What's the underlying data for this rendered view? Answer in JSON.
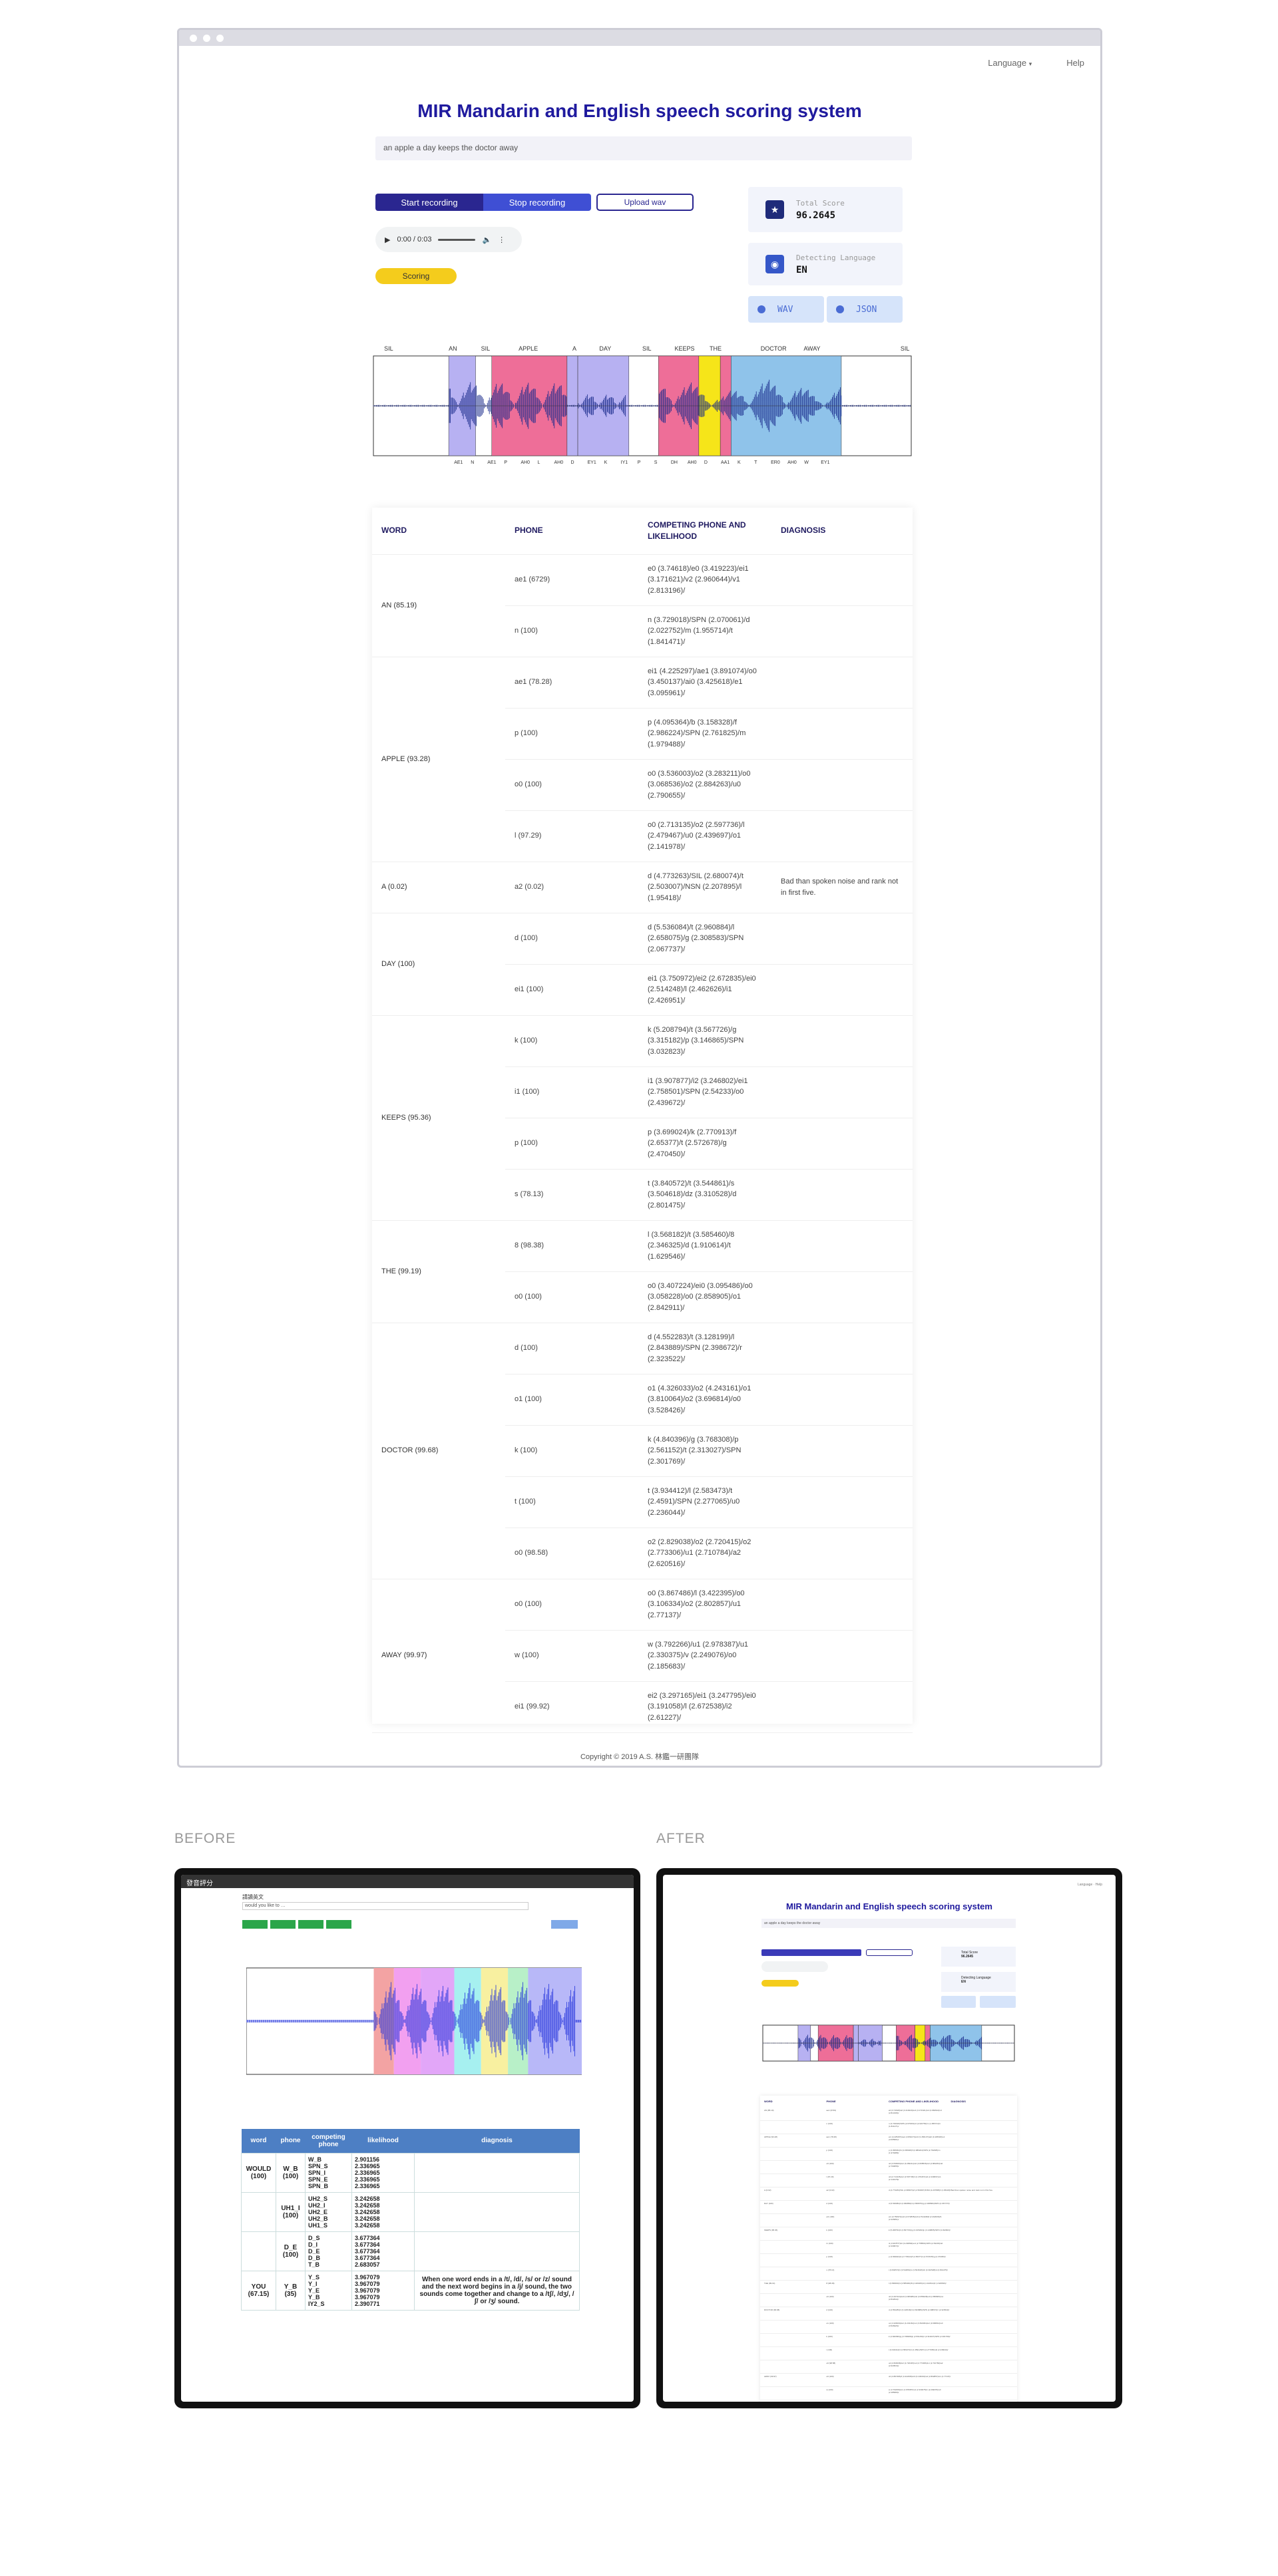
{
  "header": {
    "language_menu": "Language",
    "help_link": "Help",
    "title": "MIR Mandarin and English speech scoring system",
    "sentence": "an apple a day keeps the doctor away"
  },
  "controls": {
    "start_recording": "Start recording",
    "stop_recording": "Stop recording",
    "upload_wav": "Upload wav",
    "player_time": "0:00 / 0:03",
    "scoring": "Scoring"
  },
  "score_cards": {
    "total_label": "Total Score",
    "total_value": "96.2645",
    "lang_label": "Detecting Language",
    "lang_value": "EN",
    "wav_button": "WAV",
    "json_button": "JSON"
  },
  "waveform": {
    "word_labels": [
      "SIL",
      "AN",
      "SIL",
      "APPLE",
      "A",
      "DAY",
      "SIL",
      "KEEPS",
      "THE",
      "DOCTOR",
      "AWAY",
      "SIL"
    ],
    "phone_labels": [
      "AE1",
      "N",
      "AE1",
      "P",
      "AH0",
      "L",
      "AH0",
      "D",
      "EY1",
      "K",
      "IY1",
      "P",
      "S",
      "DH",
      "AH0",
      "D",
      "AA1",
      "K",
      "T",
      "ER0",
      "AH0",
      "W",
      "EY1"
    ],
    "colors": {
      "purple": "#b7b1f2",
      "pink": "#ee6e98",
      "yellow": "#f6e519",
      "blue": "#8fc3ea",
      "wave": "#1a2b8c"
    }
  },
  "table": {
    "headers": [
      "WORD",
      "PHONE",
      "COMPETING PHONE AND LIKELIHOOD",
      "DIAGNOSIS"
    ],
    "groups": [
      {
        "word": "AN (85.19)",
        "rows": [
          {
            "phone": "ae1 (6729)",
            "competing": "e0 (3.74618)/e0 (3.419223)/ei1 (3.171621)/v2 (2.960644)/v1 (2.813196)/",
            "diagnosis": ""
          },
          {
            "phone": "n (100)",
            "competing": "n (3.729018)/SPN (2.070061)/d (2.022752)/m (1.955714)/t (1.841471)/",
            "diagnosis": ""
          }
        ]
      },
      {
        "word": "APPLE (93.28)",
        "rows": [
          {
            "phone": "ae1 (78.28)",
            "competing": "ei1 (4.225297)/ae1 (3.891074)/o0 (3.450137)/ai0 (3.425618)/e1 (3.095961)/",
            "diagnosis": ""
          },
          {
            "phone": "p (100)",
            "competing": "p (4.095364)/b (3.158328)/f (2.986224)/SPN (2.761825)/m (1.979488)/",
            "diagnosis": ""
          },
          {
            "phone": "o0 (100)",
            "competing": "o0 (3.536003)/o2 (3.283211)/o0 (3.068536)/o2 (2.884263)/u0 (2.790655)/",
            "diagnosis": ""
          },
          {
            "phone": "l (97.29)",
            "competing": "o0 (2.713135)/o2 (2.597736)/l (2.479467)/u0 (2.439697)/o1 (2.141978)/",
            "diagnosis": ""
          }
        ]
      },
      {
        "word": "A (0.02)",
        "rows": [
          {
            "phone": "a2 (0.02)",
            "competing": "d (4.773263)/SIL (2.680074)/t (2.503007)/NSN (2.207895)/l (1.95418)/",
            "diagnosis": "Bad than spoken noise and rank not in first five."
          }
        ]
      },
      {
        "word": "DAY (100)",
        "rows": [
          {
            "phone": "d (100)",
            "competing": "d (5.536084)/t (2.960884)/l (2.658075)/g (2.308583)/SPN (2.067737)/",
            "diagnosis": ""
          },
          {
            "phone": "ei1 (100)",
            "competing": "ei1 (3.750972)/ei2 (2.672835)/ei0 (2.514248)/l (2.462626)/i1 (2.426951)/",
            "diagnosis": ""
          }
        ]
      },
      {
        "word": "KEEPS (95.36)",
        "rows": [
          {
            "phone": "k (100)",
            "competing": "k (5.208794)/t (3.567726)/g (3.315182)/p (3.146865)/SPN (3.032823)/",
            "diagnosis": ""
          },
          {
            "phone": "i1 (100)",
            "competing": "i1 (3.907877)/i2 (3.246802)/ei1 (2.758501)/SPN (2.54233)/o0 (2.439672)/",
            "diagnosis": ""
          },
          {
            "phone": "p (100)",
            "competing": "p (3.699024)/k (2.770913)/f (2.65377)/t (2.572678)/g (2.470450)/",
            "diagnosis": ""
          },
          {
            "phone": "s (78.13)",
            "competing": "t (3.840572)/t (3.544861)/s (3.504618)/dz (3.310528)/d (2.801475)/",
            "diagnosis": ""
          }
        ]
      },
      {
        "word": "THE (99.19)",
        "rows": [
          {
            "phone": "8 (98.38)",
            "competing": "l (3.568182)/t (3.585460)/8 (2.346325)/d (1.910614)/t (1.629546)/",
            "diagnosis": ""
          },
          {
            "phone": "o0 (100)",
            "competing": "o0 (3.407224)/ei0 (3.095486)/o0 (3.058228)/o0 (2.858905)/o1 (2.842911)/",
            "diagnosis": ""
          }
        ]
      },
      {
        "word": "DOCTOR (99.68)",
        "rows": [
          {
            "phone": "d (100)",
            "competing": "d (4.552283)/t (3.128199)/l (2.843889)/SPN (2.398672)/r (2.323522)/",
            "diagnosis": ""
          },
          {
            "phone": "o1 (100)",
            "competing": "o1 (4.326033)/o2 (4.243161)/o1 (3.810064)/o2 (3.696814)/o0 (3.528426)/",
            "diagnosis": ""
          },
          {
            "phone": "k (100)",
            "competing": "k (4.840396)/g (3.768308)/p (2.561152)/t (2.313027)/SPN (2.301769)/",
            "diagnosis": ""
          },
          {
            "phone": "t (100)",
            "competing": "t (3.934412)/l (2.583473)/t (2.4591)/SPN (2.277065)/u0 (2.236044)/",
            "diagnosis": ""
          },
          {
            "phone": "o0 (98.58)",
            "competing": "o2 (2.829038)/o2 (2.720415)/o2 (2.773306)/u1 (2.710784)/a2 (2.620516)/",
            "diagnosis": ""
          }
        ]
      },
      {
        "word": "AWAY (99.97)",
        "rows": [
          {
            "phone": "o0 (100)",
            "competing": "o0 (3.867486)/l (3.422395)/o0 (3.106334)/o2 (2.802857)/u1 (2.77137)/",
            "diagnosis": ""
          },
          {
            "phone": "w (100)",
            "competing": "w (3.792266)/u1 (2.978387)/u1 (2.330375)/v (2.249076)/o0 (2.185683)/",
            "diagnosis": ""
          },
          {
            "phone": "ei1 (99.92)",
            "competing": "ei2 (3.297165)/ei1 (3.247795)/ei0 (3.191058)/l (2.672538)/i2 (2.61227)/",
            "diagnosis": ""
          }
        ]
      }
    ]
  },
  "footer": {
    "copyright": "Copyright © 2019 A.S. 林鑑一研團隊"
  },
  "comparison": {
    "before_label": "BEFORE",
    "after_label": "AFTER",
    "before_app_title": "發音評分",
    "before_headers": [
      "word",
      "phone",
      "competing phone",
      "likelihood",
      "diagnosis"
    ],
    "before_diagnosis": "When one word ends in a /t/, /d/, /s/ or /z/ sound and the next word begins in a /j/ sound, the two sounds come together and change to a /tʃ/, /dʒ/, /ʃ/ or /ʒ/ sound.",
    "before_rows": [
      {
        "word": "WOULD (100)",
        "phone": "W_B (100)",
        "competing": [
          "W_B",
          "SPN_S",
          "SPN_I",
          "SPN_E",
          "SPN_B"
        ],
        "likelihood": [
          "2.901156",
          "2.336965",
          "2.336965",
          "2.336965",
          "2.336965"
        ]
      },
      {
        "word": "",
        "phone": "UH1_I (100)",
        "competing": [
          "UH2_S",
          "UH2_I",
          "UH2_E",
          "UH2_B",
          "UH1_S"
        ],
        "likelihood": [
          "3.242658",
          "3.242658",
          "3.242658",
          "3.242658",
          "3.242658"
        ]
      },
      {
        "word": "",
        "phone": "D_E (100)",
        "competing": [
          "D_S",
          "D_I",
          "D_E",
          "D_B",
          "T_B"
        ],
        "likelihood": [
          "3.677364",
          "3.677364",
          "3.677364",
          "3.677364",
          "2.683057"
        ]
      },
      {
        "word": "YOU (67.15)",
        "phone": "Y_B (35)",
        "competing": [
          "Y_S",
          "Y_I",
          "Y_E",
          "Y_B",
          "IY2_S"
        ],
        "likelihood": [
          "3.967079",
          "3.967079",
          "3.967079",
          "3.967079",
          "2.390771"
        ]
      }
    ]
  }
}
